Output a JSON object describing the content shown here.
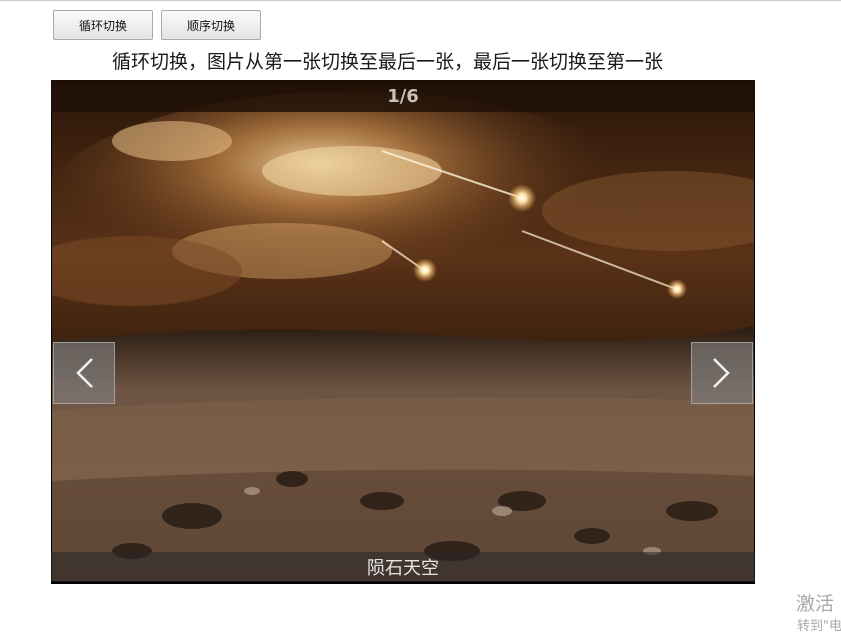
{
  "toolbar": {
    "loop_button": "循环切换",
    "order_button": "顺序切换"
  },
  "description": "循环切换，图片从第一张切换至最后一张，最后一张切换至第一张",
  "slider": {
    "current": 1,
    "total": 6,
    "counter_text": "1/6",
    "caption": "陨石天空"
  },
  "watermark": {
    "line1": "激活",
    "line2": "转到\"电"
  },
  "colors": {
    "sky_dark": "#3a1e0b",
    "sky_light": "#d9a669",
    "ground": "#5a4536"
  }
}
